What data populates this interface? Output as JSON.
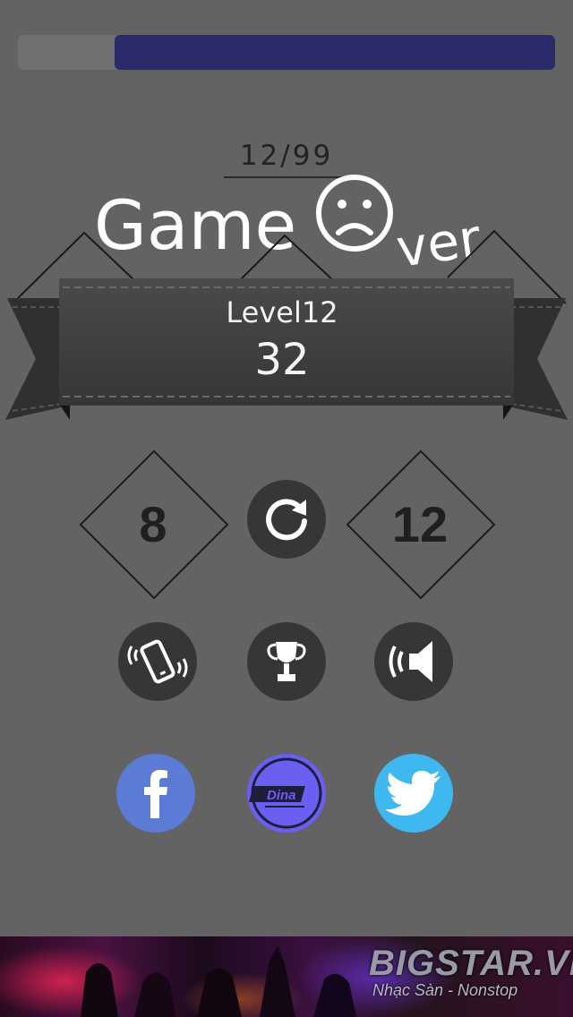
{
  "progress": {
    "value": 0.82,
    "fill_color": "#2b2b6c"
  },
  "header": {
    "counter": "12/99",
    "title": "Game Over",
    "title_icon": "sad-face-icon"
  },
  "result": {
    "level_label": "Level12",
    "score": "32"
  },
  "stats": {
    "left_value": "8",
    "right_value": "12",
    "retry_icon": "retry-icon"
  },
  "actions": {
    "vibrate_icon": "vibrate-icon",
    "leaderboard_icon": "trophy-icon",
    "sound_icon": "speaker-icon"
  },
  "social": {
    "facebook_icon": "facebook-icon",
    "facebook_color": "#5b7bd5",
    "brand_logo": "Dina",
    "brand_color": "#6b5ef2",
    "twitter_icon": "twitter-icon",
    "twitter_color": "#3fb7ef"
  },
  "ad": {
    "brand": "BIGSTAR.VN",
    "tagline": "Nhạc Sàn - Nonstop"
  }
}
